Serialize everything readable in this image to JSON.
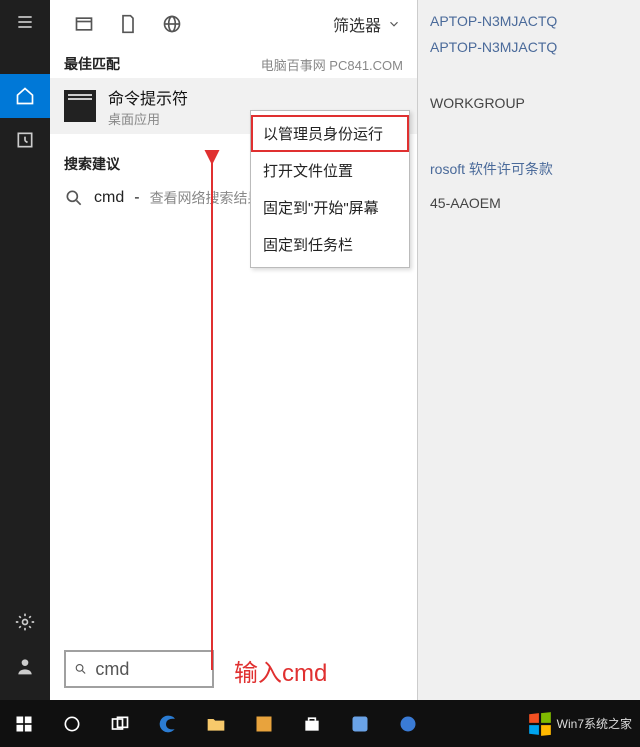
{
  "rail": {
    "items": [
      "menu-icon",
      "home-icon",
      "clock-icon",
      "settings-icon",
      "user-icon"
    ]
  },
  "tabs": {
    "filter_label": "筛选器"
  },
  "watermark": "电脑百事网 PC841.COM",
  "sections": {
    "best_match": "最佳匹配",
    "suggestions": "搜索建议"
  },
  "best_match": {
    "title": "命令提示符",
    "subtitle": "桌面应用"
  },
  "context_menu": {
    "items": [
      "以管理员身份运行",
      "打开文件位置",
      "固定到\"开始\"屏幕",
      "固定到任务栏"
    ]
  },
  "suggestion": {
    "term": "cmd",
    "hint": "查看网络搜索结果"
  },
  "search": {
    "value": "cmd"
  },
  "annotation": "输入cmd",
  "background": {
    "line1": "APTOP-N3MJACTQ",
    "line2": "APTOP-N3MJACTQ",
    "workgroup": "WORKGROUP",
    "license_prefix": "rosoft",
    "license_text": "软件许可条款",
    "product_id": "45-AAOEM"
  },
  "taskbar_logo": "Win7系统之家"
}
